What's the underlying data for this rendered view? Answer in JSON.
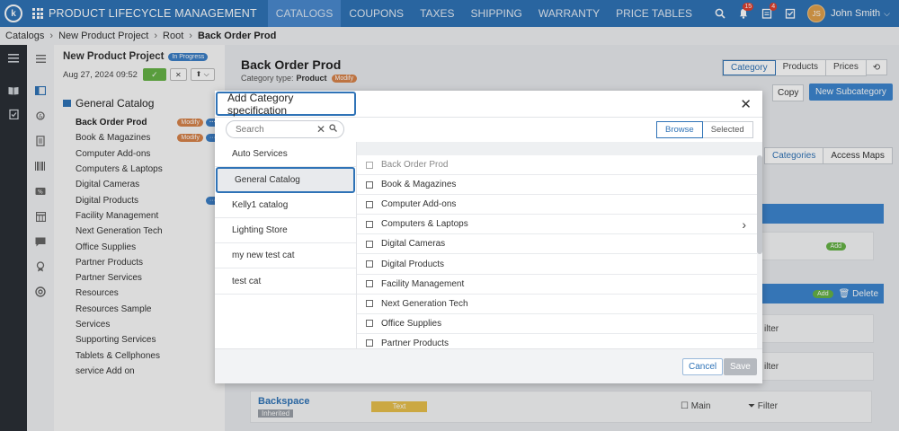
{
  "topbar": {
    "logo_letter": "k",
    "app_title": "PRODUCT LIFECYCLE MANAGEMENT",
    "nav": [
      "CATALOGS",
      "COUPONS",
      "TAXES",
      "SHIPPING",
      "WARRANTY",
      "PRICE TABLES"
    ],
    "active_nav": "CATALOGS",
    "notifications_count": "15",
    "alerts_count": "4",
    "user_initials": "JS",
    "user_name": "John Smith"
  },
  "breadcrumb": {
    "items": [
      "Catalogs",
      "New Product Project",
      "Root"
    ],
    "current": "Back Order Prod"
  },
  "project": {
    "title": "New Product Project",
    "status": "In Progress",
    "date": "Aug 27, 2024 09:52",
    "more_label": "···"
  },
  "catalog_panel": {
    "root": "General Catalog",
    "items": [
      {
        "label": "Back Order Prod",
        "tag": "Modify",
        "selected": true
      },
      {
        "label": "Book & Magazines",
        "tag": "Modify"
      },
      {
        "label": "Computer Add-ons"
      },
      {
        "label": "Computers & Laptops"
      },
      {
        "label": "Digital Cameras"
      },
      {
        "label": "Digital Products",
        "dots": true
      },
      {
        "label": "Facility Management"
      },
      {
        "label": "Next Generation Tech"
      },
      {
        "label": "Office Supplies"
      },
      {
        "label": "Partner Products"
      },
      {
        "label": "Partner Services"
      },
      {
        "label": "Resources"
      },
      {
        "label": "Resources Sample"
      },
      {
        "label": "Services"
      },
      {
        "label": "Supporting Services"
      },
      {
        "label": "Tablets & Cellphones"
      },
      {
        "label": "service Add on"
      }
    ]
  },
  "main": {
    "title": "Back Order Prod",
    "category_type_label": "Category type:",
    "category_type_value": "Product",
    "category_tag": "Modify",
    "view_tabs": [
      "Category",
      "Products",
      "Prices"
    ],
    "active_view_tab": "Category",
    "copy_label": "Copy",
    "new_subcategory_label": "New Subcategory",
    "sub_tabs": [
      "Categories",
      "Access Maps"
    ],
    "active_sub_tab": "Categories",
    "add_label": "Add",
    "delete_label": "Delete",
    "filter_label": "Filter",
    "bg_filter_partial": "ilter",
    "row": {
      "name": "Backspace",
      "inherited": "Inherited",
      "type": "Text",
      "main": "Main"
    }
  },
  "modal": {
    "title": "Add Category specification",
    "search_placeholder": "Search",
    "toggle": [
      "Browse",
      "Selected"
    ],
    "active_toggle": "Browse",
    "catalogs": [
      "Auto Services",
      "General Catalog",
      "Kelly1 catalog",
      "Lighting Store",
      "my new test cat",
      "test cat"
    ],
    "selected_catalog": "General Catalog",
    "categories": [
      {
        "label": "Back Order Prod",
        "disabled": true
      },
      {
        "label": "Book & Magazines"
      },
      {
        "label": "Computer Add-ons"
      },
      {
        "label": "Computers & Laptops",
        "has_children": true
      },
      {
        "label": "Digital Cameras"
      },
      {
        "label": "Digital Products"
      },
      {
        "label": "Facility Management"
      },
      {
        "label": "Next Generation Tech"
      },
      {
        "label": "Office Supplies"
      },
      {
        "label": "Partner Products"
      }
    ],
    "cancel_label": "Cancel",
    "save_label": "Save"
  },
  "colors": {
    "brand": "#2f73b7",
    "modify_tag": "#d8834b",
    "add_green": "#66b346",
    "text_tag": "#e8c04c"
  }
}
